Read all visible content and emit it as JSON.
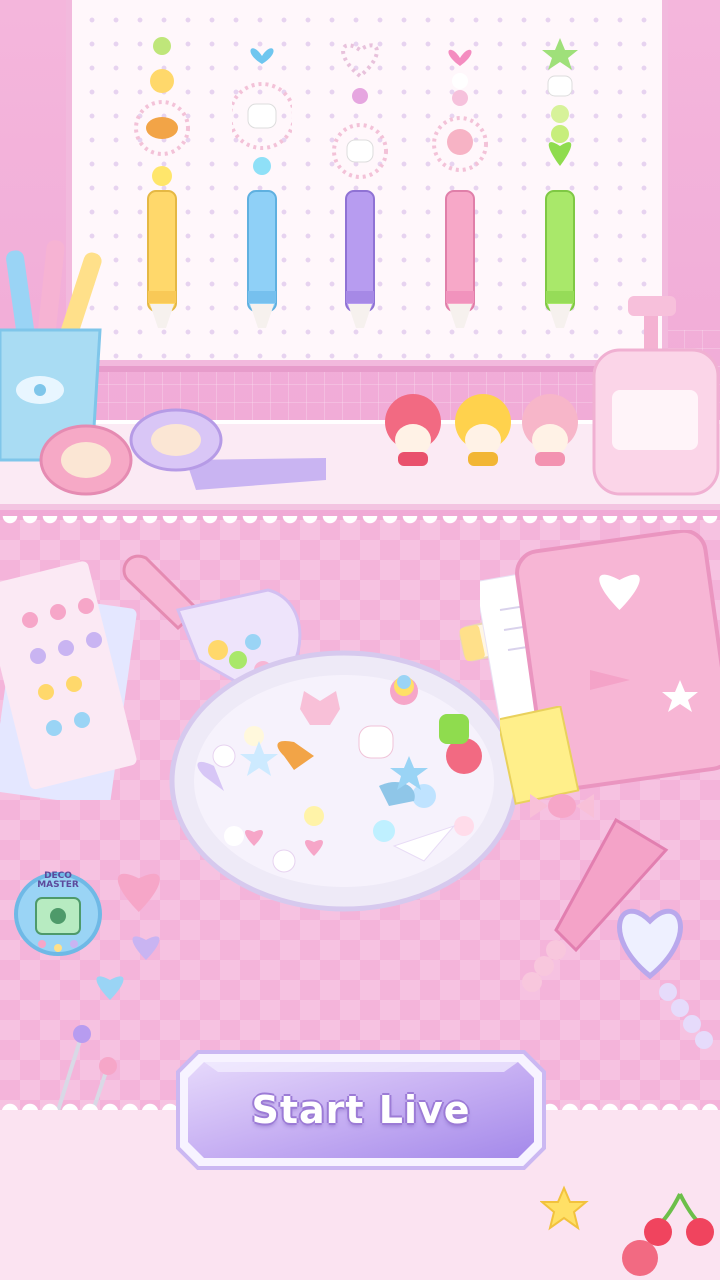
{
  "screen": "start",
  "button": {
    "start_label": "Start Live"
  },
  "device": {
    "brand_label": "DECO\nMASTER"
  },
  "colors": {
    "accent": "#b79cf0",
    "pink": "#f4b4da",
    "wall": "#f0a9d6"
  },
  "pens": [
    {
      "name": "yellow-pen",
      "color": "#ffd86b"
    },
    {
      "name": "blue-pen",
      "color": "#8fd0f7"
    },
    {
      "name": "purple-pen",
      "color": "#b79cf0"
    },
    {
      "name": "pink-pen",
      "color": "#f7a8c8"
    },
    {
      "name": "green-pen",
      "color": "#a9e86a"
    }
  ]
}
